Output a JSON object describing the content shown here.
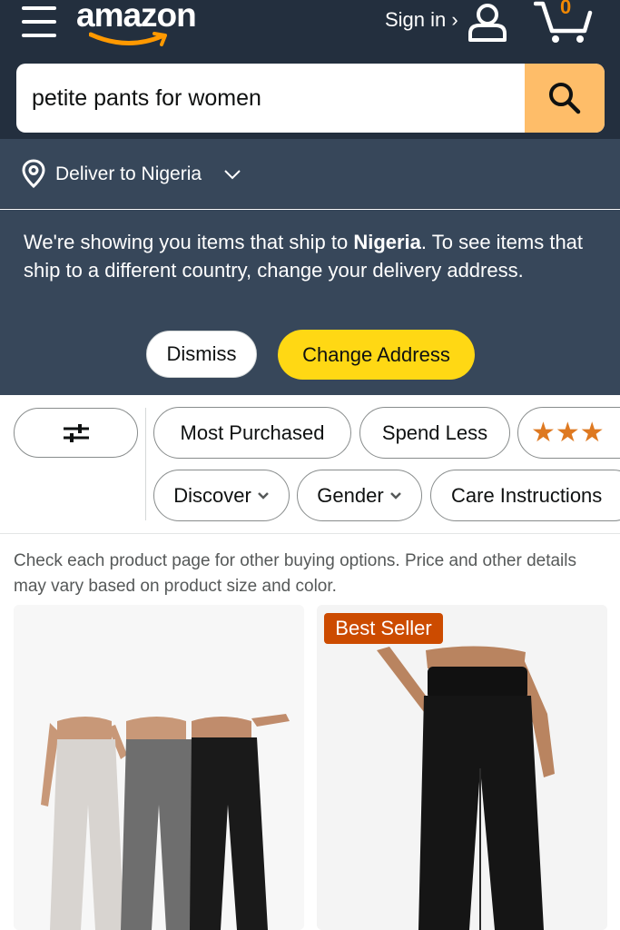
{
  "header": {
    "logo_text": "amazon",
    "signin_label": "Sign in ›",
    "cart_count": "0"
  },
  "search": {
    "value": "petite pants for women"
  },
  "deliver": {
    "label": "Deliver to Nigeria"
  },
  "notice": {
    "text_before": "We're showing you items that ship to ",
    "country": "Nigeria",
    "text_after": ". To see items that ship to a different country, change your delivery address.",
    "dismiss_label": "Dismiss",
    "change_label": "Change Address"
  },
  "filters": {
    "chips_row1": [
      "Most Purchased",
      "Spend Less"
    ],
    "stars": "★★★",
    "chips_row2": [
      "Discover",
      "Gender",
      "Care Instructions"
    ]
  },
  "results": {
    "note": "Check each product page for other buying options. Price and other details may vary based on product size and color."
  },
  "products": [
    {
      "badge": ""
    },
    {
      "badge": "Best Seller"
    }
  ],
  "colors": {
    "nav_bg": "#232f3e",
    "subnav_bg": "#37475a",
    "search_button": "#febd69",
    "change_button": "#ffd814",
    "badge": "#cc4b00",
    "stars": "#de7921",
    "cart_count": "#f08804"
  },
  "icons": [
    "hamburger-menu-icon",
    "user-icon",
    "cart-icon",
    "search-icon",
    "location-pin-icon",
    "chevron-down-icon",
    "filter-sliders-icon"
  ]
}
